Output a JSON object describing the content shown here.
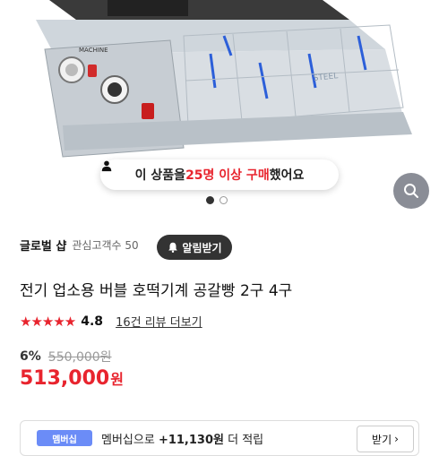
{
  "hero": {
    "machine_label": "MACHINE",
    "sticker_text": "STEEL",
    "buyers": {
      "prefix": "이 상품을 ",
      "count": "25명 이상 구매",
      "suffix": " 했어요"
    },
    "slides_total": 2,
    "slide_active": 1
  },
  "seller": {
    "name": "글로벌 샵",
    "interest": "관심고객수 50",
    "alert_button": "알림받기"
  },
  "product": {
    "title": "전기 업소용 버블 호떡기계 공갈빵 2구 4구",
    "rating": "4.8",
    "stars": "★★★★★",
    "review_link": "16건 리뷰 더보기",
    "discount": "6%",
    "original_price": "550,000원",
    "price_number": "513,000",
    "price_unit": "원"
  },
  "member": {
    "badge": "멤버십",
    "text_prefix": "멤버십으로 ",
    "points": "+11,130원",
    "text_suffix": " 더 적립",
    "receive_button": "받기"
  },
  "colors": {
    "accent": "#e8242e",
    "dark": "#333333",
    "fab": "#8a8d96"
  }
}
